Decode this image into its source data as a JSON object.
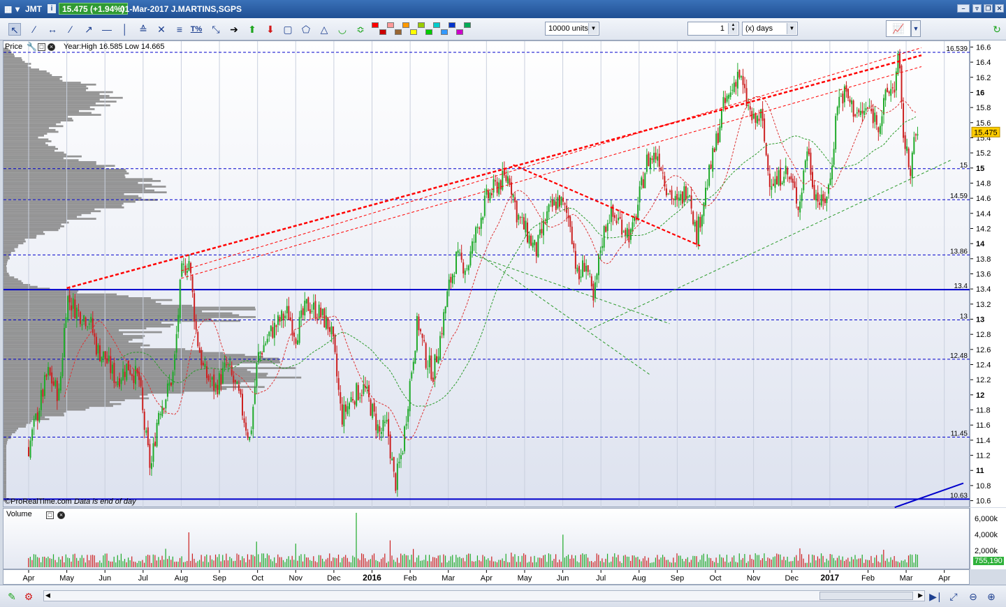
{
  "titlebar": {
    "ticker": "JMT",
    "price_badge": "15.475 (+1.94%)",
    "date_name": "01-Mar-2017 J.MARTINS,SGPS",
    "icons": [
      "chart-icon",
      "info-icon",
      "minimize-icon",
      "restore-icon",
      "close-icon"
    ]
  },
  "toolbar": {
    "units_value": "10000 units",
    "days_value": "1",
    "days_unit": "(x) days",
    "tool_icons": [
      "pointer-icon",
      "ruler-icon",
      "horizontal-line-icon",
      "trend-line-icon",
      "ray-icon",
      "segment-icon",
      "vertical-line-icon",
      "channel-icon",
      "fibonacci-icon",
      "fib-fan-icon",
      "fib-retracement-icon",
      "percent-icon",
      "cross-icon",
      "arrow-right-icon",
      "arrow-up-icon",
      "arrow-down-icon",
      "rectangle-icon",
      "lasso-icon",
      "triangle-icon",
      "arc-icon",
      "pitchfork-icon"
    ],
    "swatch_colors": [
      "#ff0000",
      "#cc0000",
      "#ff9999",
      "#996633",
      "#ff9900",
      "#ffff00",
      "#99cc00",
      "#00cc00",
      "#00cccc",
      "#3399ff",
      "#0033cc",
      "#cc00cc",
      "#00aa55"
    ]
  },
  "price_panel": {
    "label": "Price",
    "info": "Year:High 16.585 Low 14.665",
    "footer": "©ProRealTime.com",
    "footer_note": "Data is end of day",
    "current_price": "15.475"
  },
  "volume_panel": {
    "label": "Volume",
    "current_volume": "755,190",
    "axis_labels": [
      "6,000k",
      "4,000k",
      "2,000k"
    ]
  },
  "colors": {
    "up_candle": "#1faa2a",
    "down_candle": "#cc2020",
    "support_line": "#0000cc",
    "resistance_red": "#ff0000",
    "ma_green": "#2a9a2a",
    "ma_red": "#dd3333",
    "volume_profile": "#8a8a8a"
  },
  "chart_data": {
    "type": "candlestick",
    "ylim": [
      10.55,
      16.65
    ],
    "y_ticks": [
      10.6,
      10.8,
      11,
      11.2,
      11.4,
      11.6,
      11.8,
      12,
      12.2,
      12.4,
      12.6,
      12.8,
      13,
      13.2,
      13.4,
      13.6,
      13.8,
      14,
      14.2,
      14.4,
      14.6,
      14.8,
      15,
      15.2,
      15.4,
      15.6,
      15.8,
      16,
      16.2,
      16.4,
      16.6
    ],
    "y_tick_labels": [
      "10.6",
      "10.8",
      "11",
      "11.2",
      "11.4",
      "11.6",
      "11.8",
      "12",
      "12.2",
      "12.4",
      "12.6",
      "12.8",
      "13",
      "13.2",
      "13.4",
      "13.6",
      "13.8",
      "14",
      "14.2",
      "14.4",
      "14.6",
      "14.8",
      "15",
      "15.2",
      "15.4",
      "15.6",
      "15.8",
      "16",
      "16.2",
      "16.4",
      "16.6"
    ],
    "x_tick_labels": [
      "Apr",
      "May",
      "Jun",
      "Jul",
      "Aug",
      "Sep",
      "Oct",
      "Nov",
      "Dec",
      "2016",
      "Feb",
      "Mar",
      "Apr",
      "May",
      "Jun",
      "Jul",
      "Aug",
      "Sep",
      "Oct",
      "Nov",
      "Dec",
      "2017",
      "Feb",
      "Mar",
      "Apr"
    ],
    "x_tick_months": [
      0,
      1,
      2,
      3,
      4,
      5,
      6,
      7,
      8,
      9,
      10,
      11,
      12,
      13,
      14,
      15,
      16,
      17,
      18,
      19,
      20,
      21,
      22,
      23,
      24
    ],
    "horizontal_levels": [
      {
        "value": 16.539,
        "label": "16.539",
        "style": "dashed"
      },
      {
        "value": 15.0,
        "label": "15",
        "style": "dashed"
      },
      {
        "value": 14.59,
        "label": "14.59",
        "style": "dashed"
      },
      {
        "value": 13.86,
        "label": "13.86",
        "style": "dashed"
      },
      {
        "value": 13.4,
        "label": "13.4",
        "style": "solid"
      },
      {
        "value": 13.0,
        "label": "13",
        "style": "dashed"
      },
      {
        "value": 12.48,
        "label": "12.48",
        "style": "dashed"
      },
      {
        "value": 11.45,
        "label": "11.45",
        "style": "dashed"
      },
      {
        "value": 10.63,
        "label": "10.63",
        "style": "solid"
      }
    ],
    "price_path": [
      [
        0.0,
        11.3
      ],
      [
        0.3,
        11.9
      ],
      [
        0.5,
        12.3
      ],
      [
        0.8,
        12.0
      ],
      [
        1.0,
        13.3
      ],
      [
        1.3,
        13.1
      ],
      [
        1.6,
        13.0
      ],
      [
        1.8,
        12.6
      ],
      [
        2.0,
        12.5
      ],
      [
        2.3,
        12.2
      ],
      [
        2.6,
        12.4
      ],
      [
        2.9,
        12.2
      ],
      [
        3.0,
        11.7
      ],
      [
        3.2,
        11.0
      ],
      [
        3.4,
        11.8
      ],
      [
        3.6,
        12.0
      ],
      [
        3.8,
        12.3
      ],
      [
        4.0,
        13.6
      ],
      [
        4.2,
        13.8
      ],
      [
        4.4,
        12.8
      ],
      [
        4.6,
        12.3
      ],
      [
        4.9,
        12.1
      ],
      [
        5.2,
        12.4
      ],
      [
        5.5,
        12.0
      ],
      [
        5.8,
        11.4
      ],
      [
        6.0,
        12.5
      ],
      [
        6.3,
        12.8
      ],
      [
        6.6,
        13.0
      ],
      [
        6.8,
        13.1
      ],
      [
        7.0,
        12.8
      ],
      [
        7.3,
        13.2
      ],
      [
        7.6,
        13.1
      ],
      [
        7.9,
        12.9
      ],
      [
        8.0,
        12.6
      ],
      [
        8.2,
        11.7
      ],
      [
        8.5,
        12.0
      ],
      [
        8.8,
        12.1
      ],
      [
        9.0,
        11.8
      ],
      [
        9.2,
        11.5
      ],
      [
        9.4,
        11.6
      ],
      [
        9.6,
        10.8
      ],
      [
        9.8,
        11.3
      ],
      [
        10.0,
        12.2
      ],
      [
        10.2,
        13.0
      ],
      [
        10.4,
        12.5
      ],
      [
        10.6,
        12.3
      ],
      [
        10.8,
        12.8
      ],
      [
        11.0,
        13.4
      ],
      [
        11.2,
        13.8
      ],
      [
        11.5,
        13.7
      ],
      [
        11.8,
        14.3
      ],
      [
        12.0,
        14.6
      ],
      [
        12.3,
        14.8
      ],
      [
        12.6,
        14.9
      ],
      [
        12.8,
        14.4
      ],
      [
        13.0,
        14.2
      ],
      [
        13.3,
        13.9
      ],
      [
        13.6,
        14.4
      ],
      [
        13.9,
        14.6
      ],
      [
        14.2,
        14.3
      ],
      [
        14.4,
        13.5
      ],
      [
        14.6,
        13.8
      ],
      [
        14.8,
        13.2
      ],
      [
        15.0,
        14.0
      ],
      [
        15.2,
        14.4
      ],
      [
        15.5,
        14.3
      ],
      [
        15.8,
        14.1
      ],
      [
        16.0,
        14.6
      ],
      [
        16.2,
        15.1
      ],
      [
        16.5,
        15.2
      ],
      [
        16.7,
        14.8
      ],
      [
        17.0,
        14.5
      ],
      [
        17.3,
        14.8
      ],
      [
        17.5,
        14.1
      ],
      [
        17.7,
        14.6
      ],
      [
        18.0,
        15.3
      ],
      [
        18.2,
        15.8
      ],
      [
        18.4,
        16.0
      ],
      [
        18.6,
        16.3
      ],
      [
        18.8,
        15.9
      ],
      [
        19.0,
        15.6
      ],
      [
        19.2,
        15.7
      ],
      [
        19.4,
        14.9
      ],
      [
        19.6,
        14.8
      ],
      [
        19.8,
        15.0
      ],
      [
        20.0,
        14.8
      ],
      [
        20.2,
        14.5
      ],
      [
        20.4,
        15.3
      ],
      [
        20.6,
        14.7
      ],
      [
        20.8,
        14.5
      ],
      [
        21.0,
        14.8
      ],
      [
        21.2,
        15.9
      ],
      [
        21.4,
        16.0
      ],
      [
        21.6,
        15.8
      ],
      [
        21.8,
        15.7
      ],
      [
        22.0,
        15.8
      ],
      [
        22.3,
        15.6
      ],
      [
        22.5,
        16.0
      ],
      [
        22.7,
        16.1
      ],
      [
        22.8,
        16.5
      ],
      [
        22.9,
        15.6
      ],
      [
        23.0,
        15.2
      ],
      [
        23.1,
        15.0
      ],
      [
        23.2,
        15.3
      ],
      [
        23.3,
        15.475
      ]
    ]
  }
}
